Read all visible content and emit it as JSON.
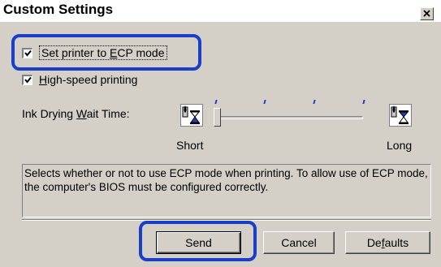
{
  "dialog": {
    "title": "Custom Settings",
    "close_glyph": "×"
  },
  "options": {
    "ecp_mode": {
      "checked": true,
      "label_before": "Set printer to ",
      "mnemonic": "E",
      "label_after": "CP mode"
    },
    "high_speed": {
      "checked": true,
      "mnemonic": "H",
      "label_after": "igh-speed printing"
    }
  },
  "ink_drying": {
    "label_before": "Ink Drying ",
    "mnemonic": "W",
    "label_after": "ait Time:",
    "min_label": "Short",
    "max_label": "Long",
    "value_fraction": 0.0,
    "tick_count": 4
  },
  "description": "Selects whether or not to use ECP mode when printing. To allow use of ECP mode, the computer's BIOS must be configured correctly.",
  "buttons": {
    "send": "Send",
    "cancel": "Cancel",
    "defaults_before": "De",
    "defaults_mnemonic": "f",
    "defaults_after": "aults"
  },
  "colors": {
    "dialog_bg": "#d4d0c8",
    "highlight_callout": "#1b3ec9"
  }
}
